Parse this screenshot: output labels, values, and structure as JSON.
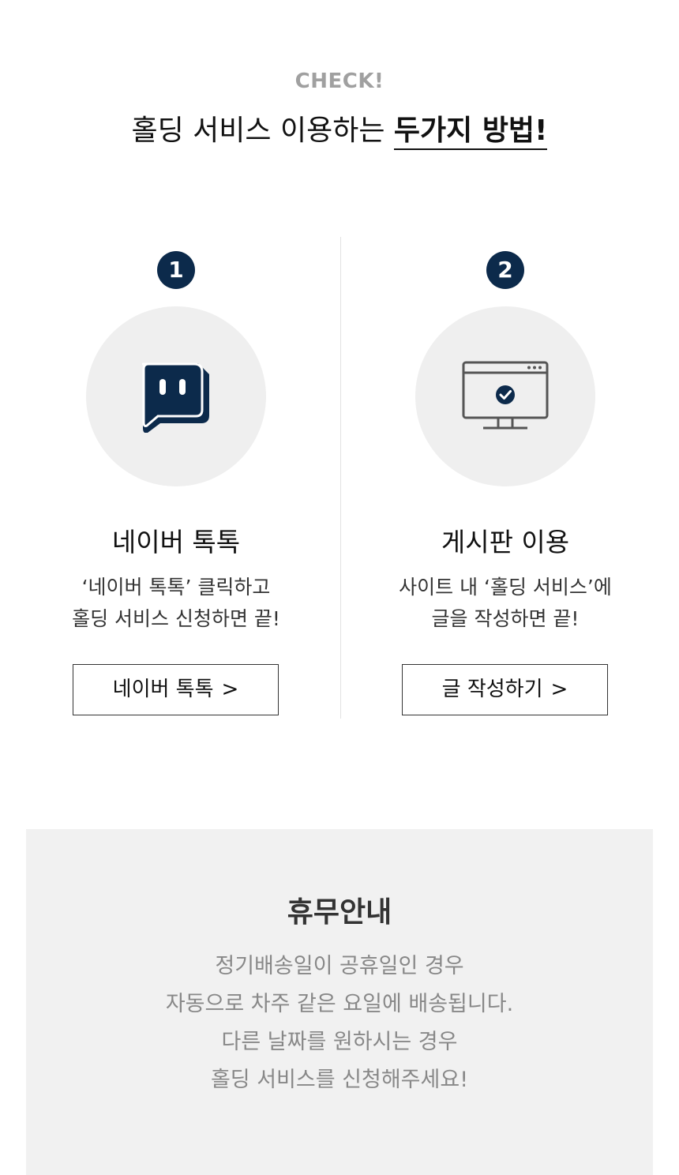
{
  "header": {
    "check_label": "CHECK!",
    "headline_prefix": "홀딩 서비스 이용하는 ",
    "headline_emphasis": "두가지 방법!"
  },
  "methods": [
    {
      "number": "1",
      "icon": "talktalk-chat-icon",
      "title": "네이버 톡톡",
      "desc_lines": [
        "‘네이버 톡톡’ 클릭하고",
        "홀딩 서비스 신청하면 끝!"
      ],
      "button_label": "네이버 톡톡",
      "button_arrow": ">"
    },
    {
      "number": "2",
      "icon": "board-monitor-check-icon",
      "title": "게시판 이용",
      "desc_lines": [
        "사이트 내 ‘홀딩 서비스’에",
        "글을 작성하면 끝!"
      ],
      "button_label": "글 작성하기",
      "button_arrow": ">"
    }
  ],
  "notice": {
    "title": "휴무안내",
    "lines": [
      "정기배송일이 공휴일인 경우",
      "자동으로 차주 같은 요일에 배송됩니다.",
      "다른 날짜를 원하시는 경우",
      "홀딩 서비스를 신청해주세요!"
    ]
  },
  "colors": {
    "accent_navy": "#0c2a4b",
    "icon_circle_bg": "#efefef",
    "notice_bg": "#f1f1f1",
    "check_label_gray": "#a0a0a0"
  }
}
